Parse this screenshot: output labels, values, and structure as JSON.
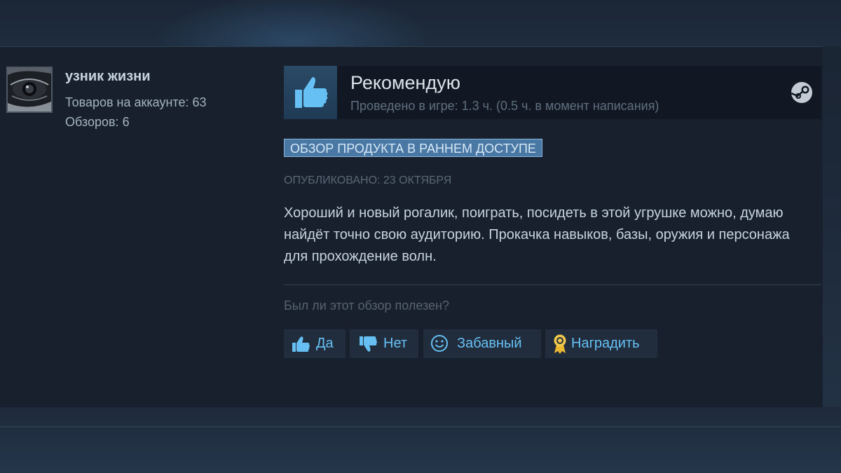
{
  "author": {
    "name": "узник жизни",
    "products": "Товаров на аккаунте: 63",
    "reviews": "Обзоров: 6",
    "avatar_icon": "eye-avatar"
  },
  "review": {
    "verdict": "Рекомендую",
    "verdict_icon": "thumbs-up-icon",
    "playtime": "Проведено в игре: 1.3 ч. (0.5 ч. в момент написания)",
    "platform_icon": "steam-logo-icon",
    "early_access_badge": "ОБЗОР ПРОДУКТА В РАННЕМ ДОСТУПЕ",
    "posted": "ОПУБЛИКОВАНО: 23 ОКТЯБРЯ",
    "text": "Хороший и новый рогалик, поиграть, посидеть в этой угрушке можно, думаю найдёт точно свою аудиторию. Прокачка навыков, базы, оружия и персонажа для прохождение волн."
  },
  "helpful": {
    "question": "Был ли этот обзор полезен?",
    "buttons": {
      "yes": "Да",
      "no": "Нет",
      "funny": "Забавный",
      "award": "Наградить"
    }
  },
  "colors": {
    "accent": "#66c0f4",
    "badge_bg": "#4a78a4",
    "card_bg": "#18202d"
  }
}
